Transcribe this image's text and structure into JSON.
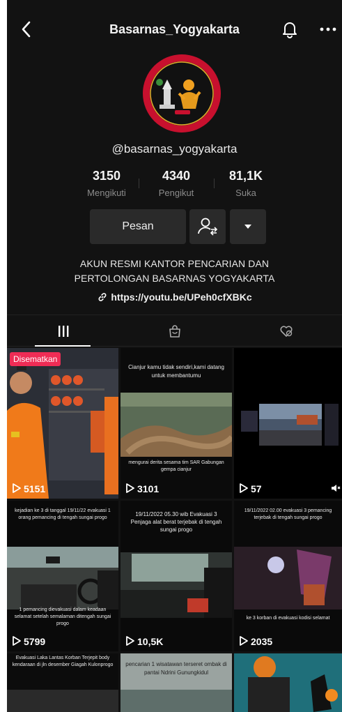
{
  "header": {
    "title": "Basarnas_Yogyakarta",
    "back_icon": "chevron-left-icon",
    "bell_icon": "bell-icon",
    "more_icon": "more-horizontal-icon"
  },
  "profile": {
    "handle": "@basarnas_yogyakarta",
    "stats": [
      {
        "value": "3150",
        "label": "Mengikuti"
      },
      {
        "value": "4340",
        "label": "Pengikut"
      },
      {
        "value": "81,1K",
        "label": "Suka"
      }
    ],
    "message_button": "Pesan",
    "bio_line1": "AKUN RESMI KANTOR PENCARIAN DAN",
    "bio_line2": "PERTOLONGAN BASARNAS YOGYAKARTA",
    "link": "https://youtu.be/UPeh0cfXBKc"
  },
  "tabs": [
    {
      "name": "videos-grid-icon",
      "active": true
    },
    {
      "name": "shop-bag-icon",
      "active": false
    },
    {
      "name": "liked-heart-icon",
      "active": false
    }
  ],
  "videos": [
    {
      "views": "5151",
      "badge": "Disematkan",
      "caption": ""
    },
    {
      "views": "3101",
      "caption_top": "Cianjur kamu tidak sendiri,kami datang untuk membantumu",
      "caption_bottom": "mengurai derita sesama tim SAR Gabungan gempa cianjur"
    },
    {
      "views": "57",
      "caption": ""
    },
    {
      "views": "5799",
      "caption_top": "kejadian ke 3 di tanggal 19/11/22 evakuasi 1 orang pemancing di tengah sungai progo",
      "caption_bottom": "1 pemancing dievakuasi dalam keadaan selamat setelah semalaman ditengah sungai progo"
    },
    {
      "views": "10,5K",
      "caption_top": "19/11/2022 05.30 wib Evakuasi 3 Penjaga alat berat terjebak di tengah sungai progo",
      "caption_bottom": ""
    },
    {
      "views": "2035",
      "caption_top": "19/11/2022 02.00 evakuasi 3 pemancing terjebak di tengah sungai progo",
      "caption_bottom": "ke 3 korban di evakuasi kodisi selamat"
    },
    {
      "views": "",
      "caption_top": "Evakuasi Laka Lantas Korban Terjepit body kendaraan di jln desember Giagah Kulonprogo"
    },
    {
      "views": "",
      "caption_top": "pencarian 1 wisatawan terseret ombak di pantai Ndrini Gunungkidul"
    },
    {
      "views": "",
      "caption_top": ""
    }
  ]
}
